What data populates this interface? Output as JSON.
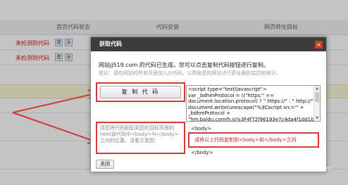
{
  "background": {
    "columns": [
      "首页代码状态",
      "代码安装",
      "网页转化目标"
    ],
    "rows": [
      {
        "status": "未检测到代码",
        "actions": [
          "查",
          "全"
        ]
      },
      {
        "status": "未检测到代码",
        "actions": [
          "查",
          "全"
        ]
      }
    ]
  },
  "dialog": {
    "title": "获取代码",
    "close_icon": "×",
    "message": "网站jj519.com 的代码已生成，您可以点击复制代码按钮进行复制。",
    "hint": "建议：请在网站的所有页面加入JS代码，以帮助您的网站进行更全面的监控和统计。",
    "copy_button": "复 制 代 码",
    "code": "<script type=\"text/javascript\">\nvar _bdhmProtocol = ((\"https:\" ==\ndocument.location.protocol) ? \" https://\" : \" http://\");\ndocument.write(unescape(\"%3Cscript src='\" +\n_bdhmProtocol +\n\"hm.baidu.com/h.js%3F4f72f96193e7c4da4f1dd1b44",
    "instruction": "请您将代码粘贴到您的目标页面的html源代码中<body>与</body>之间的位置，请看示意图：",
    "preview": {
      "open_tag": "<body>",
      "highlight": "请将以上代码复制到<body>和</body>之间",
      "close_tag": "</body>"
    },
    "close_button": "关闭"
  },
  "watermark": "jingyan.baidu.com",
  "colors": {
    "accent_red": "#d23a3a",
    "status_red": "#d00000",
    "title_bar": "#3d3d3d"
  }
}
